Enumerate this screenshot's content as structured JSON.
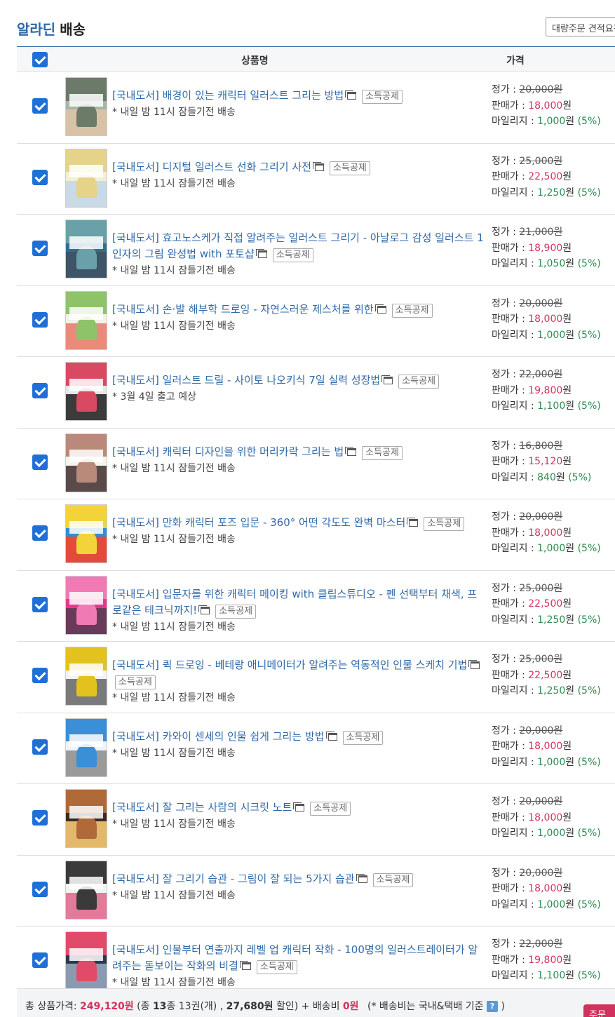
{
  "header": {
    "brand_part1": "알라딘",
    "brand_part2": "배송",
    "bulk_order_label": "대량주문 견적요청"
  },
  "columns": {
    "product": "상품명",
    "price": "가격"
  },
  "labels": {
    "list_price": "정가 : ",
    "sale_price": "판매가 : ",
    "mileage": "마일리지 : ",
    "won": "원",
    "deduct_badge": "소득공제"
  },
  "items": [
    {
      "title": "[국내도서] 배경이 있는 캐릭터 일러스트 그리는 방법",
      "ship": "* 내일 밤 11시 잠들기전 배송",
      "list": "20,000",
      "sale": "18,000",
      "mile": "1,000",
      "pct": "(5%)",
      "cover": [
        "#a7b5a6",
        "#6c7a6a",
        "#d8c2a6"
      ]
    },
    {
      "title": "[국내도서] 디지털 일러스트 선화 그리기 사전",
      "ship": "* 내일 밤 11시 잠들기전 배송",
      "list": "25,000",
      "sale": "22,500",
      "mile": "1,250",
      "pct": "(5%)",
      "cover": [
        "#f2eed7",
        "#e6d38a",
        "#c9d9e6"
      ]
    },
    {
      "title": "[국내도서] 효고노스케가 직접 알려주는 일러스트 그리기 - 아날로그 감성 일러스트 1인자의 그림 완성법 with 포토샵",
      "ship": "* 내일 밤 11시 잠들기전 배송",
      "list": "21,000",
      "sale": "18,900",
      "mile": "1,050",
      "pct": "(5%)",
      "cover": [
        "#2f6f8f",
        "#6aa0a8",
        "#3d5566"
      ]
    },
    {
      "title": "[국내도서] 손·발 해부학 드로잉 - 자연스러운 제스처를 위한",
      "ship": "* 내일 밤 11시 잠들기전 배송",
      "list": "20,000",
      "sale": "18,000",
      "mile": "1,000",
      "pct": "(5%)",
      "cover": [
        "#f4f1ea",
        "#8fc36a",
        "#e98a7b"
      ]
    },
    {
      "title": "[국내도서] 일러스트 드릴 - 사이토 나오키식 7일 실력 성장법",
      "ship": "* 3월 4일 출고 예상",
      "list": "22,000",
      "sale": "19,800",
      "mile": "1,100",
      "pct": "(5%)",
      "cover": [
        "#e9e6e6",
        "#d94a62",
        "#3b3b3b"
      ]
    },
    {
      "title": "[국내도서] 캐릭터 디자인을 위한 머리카락 그리는 법",
      "ship": "* 내일 밤 11시 잠들기전 배송",
      "list": "16,800",
      "sale": "15,120",
      "mile": "840",
      "pct": "(5%)",
      "cover": [
        "#f7f4ee",
        "#b98a7a",
        "#5a4a4a"
      ]
    },
    {
      "title": "[국내도서] 만화 캐릭터 포즈 입문 - 360° 어떤 각도도 완벽 마스터",
      "ship": "* 내일 밤 11시 잠들기전 배송",
      "list": "20,000",
      "sale": "18,000",
      "mile": "1,000",
      "pct": "(5%)",
      "cover": [
        "#2f8fd0",
        "#f2d43a",
        "#e34a3a"
      ]
    },
    {
      "title": "[국내도서] 입문자를 위한 캐릭터 메이킹 with 클립스튜디오 - 펜 선택부터 채색, 프로같은 테크닉까지!",
      "ship": "* 내일 밤 11시 잠들기전 배송",
      "list": "25,000",
      "sale": "22,500",
      "mile": "1,250",
      "pct": "(5%)",
      "cover": [
        "#e9368a",
        "#f07ab4",
        "#6a3a5a"
      ]
    },
    {
      "title": "[국내도서] 퀵 드로잉 - 베테랑 애니메이터가 알려주는 역동적인 인물 스케치 기법",
      "ship": "* 내일 밤 11시 잠들기전 배송",
      "list": "25,000",
      "sale": "22,500",
      "mile": "1,250",
      "pct": "(5%)",
      "cover": [
        "#f3f3f0",
        "#e3c21d",
        "#7a7a7a"
      ]
    },
    {
      "title": "[국내도서] 카와이 센세의 인물 쉽게 그리는 방법",
      "ship": "* 내일 밤 11시 잠들기전 배송",
      "list": "20,000",
      "sale": "18,000",
      "mile": "1,000",
      "pct": "(5%)",
      "cover": [
        "#eef4f8",
        "#3a8fd6",
        "#9a9a9a"
      ]
    },
    {
      "title": "[국내도서] 잘 그리는 사람의 시크릿 노트",
      "ship": "* 내일 밤 11시 잠들기전 배송",
      "list": "20,000",
      "sale": "18,000",
      "mile": "1,000",
      "pct": "(5%)",
      "cover": [
        "#3a2a22",
        "#b06a3a",
        "#e2b86a"
      ]
    },
    {
      "title": "[국내도서] 잘 그리기 습관 - 그림이 잘 되는 5가지 습관",
      "ship": "* 내일 밤 11시 잠들기전 배송",
      "list": "20,000",
      "sale": "18,000",
      "mile": "1,000",
      "pct": "(5%)",
      "cover": [
        "#f4f2ef",
        "#3a3a3a",
        "#e27a9a"
      ]
    },
    {
      "title": "[국내도서] 인물부터 연출까지 레벨 업 캐릭터 작화 - 100명의 일러스트레이터가 알려주는 돋보이는 작화의 비결",
      "ship": "* 내일 밤 11시 잠들기전 배송",
      "list": "22,000",
      "sale": "19,800",
      "mile": "1,100",
      "pct": "(5%)",
      "cover": [
        "#2a3a4a",
        "#e24a6a",
        "#8a9ab0"
      ]
    }
  ],
  "footer": {
    "label_total": "총 상품가격: ",
    "total": "249,120원",
    "paren_open": " (종 ",
    "kinds": "13",
    "kinds_unit": "종 13권(개) , ",
    "discount": "27,680원",
    "discount_suffix": " 할인) + 배송비 ",
    "shipping": "0원",
    "note": "(* 배송비는 국내&택배 기준",
    "note_close": ")",
    "q_icon": "?",
    "order_label": "주문하기"
  }
}
